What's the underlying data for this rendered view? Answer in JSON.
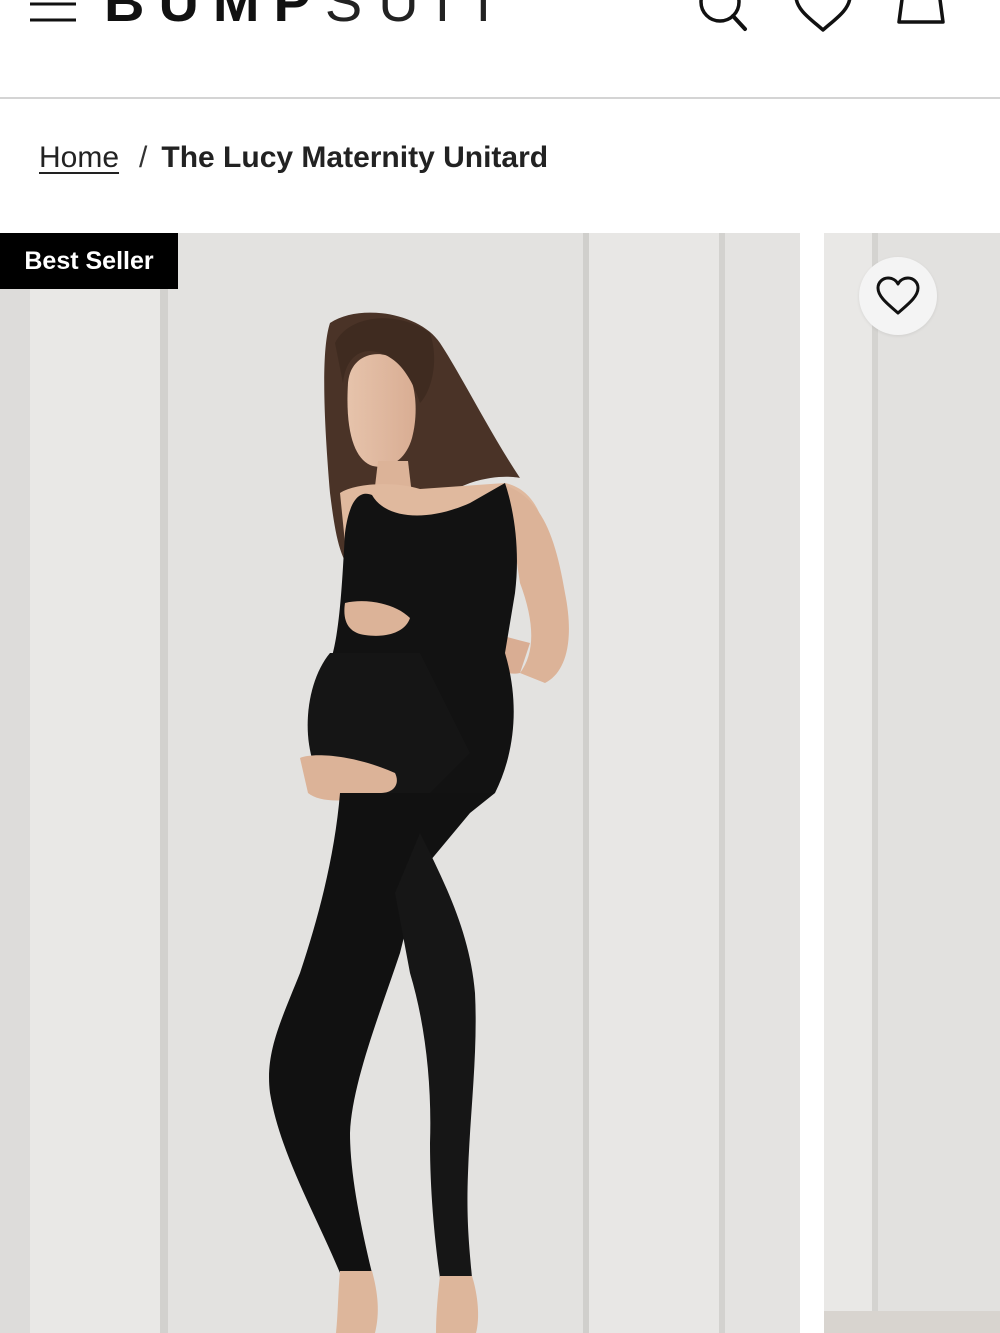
{
  "header": {
    "logo_bold": "BUMP",
    "logo_light": "SUIT",
    "menu_icon": "hamburger-menu-icon",
    "search_icon": "search-icon",
    "wishlist_icon": "heart-icon",
    "cart_icon": "shopping-bag-icon"
  },
  "breadcrumb": {
    "home": "Home",
    "separator": "/",
    "current": "The Lucy Maternity Unitard"
  },
  "product": {
    "badge": "Best Seller",
    "wishlist_icon": "heart-outline-icon",
    "image_alt": "Pregnant model wearing black maternity unitard"
  },
  "colors": {
    "badge_bg": "#000000",
    "badge_text": "#ffffff",
    "unitard": "#111111",
    "backdrop": "#e6e5e3"
  }
}
